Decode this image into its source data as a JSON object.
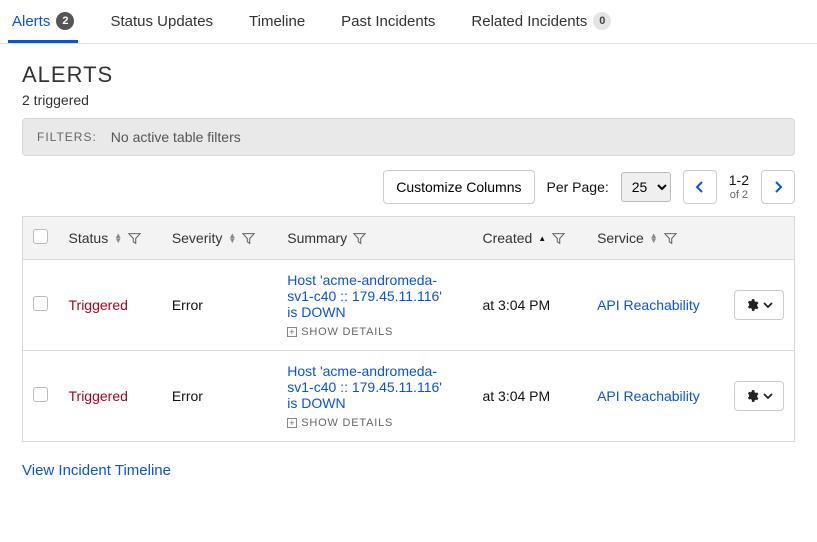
{
  "tabs": [
    {
      "label": "Alerts",
      "badge": "2",
      "badgeStyle": "dark",
      "active": true
    },
    {
      "label": "Status Updates",
      "badge": null
    },
    {
      "label": "Timeline",
      "badge": null
    },
    {
      "label": "Past Incidents",
      "badge": null
    },
    {
      "label": "Related Incidents",
      "badge": "0",
      "badgeStyle": "light"
    }
  ],
  "header": {
    "title": "ALERTS",
    "subtitle": "2 triggered"
  },
  "filters": {
    "label": "FILTERS:",
    "text": "No active table filters"
  },
  "toolbar": {
    "customize": "Customize Columns",
    "per_page_label": "Per Page:",
    "per_page_value": "25",
    "page_range": "1-2",
    "page_total": "of 2"
  },
  "columns": {
    "status": "Status",
    "severity": "Severity",
    "summary": "Summary",
    "created": "Created",
    "service": "Service"
  },
  "rows": [
    {
      "status": "Triggered",
      "severity": "Error",
      "summary": "Host 'acme-andromeda-sv1-c40 :: 179.45.11.116' is DOWN",
      "show_details": "SHOW DETAILS",
      "created": "at 3:04 PM",
      "service": "API Reachability"
    },
    {
      "status": "Triggered",
      "severity": "Error",
      "summary": "Host 'acme-andromeda-sv1-c40 :: 179.45.11.116' is DOWN",
      "show_details": "SHOW DETAILS",
      "created": "at 3:04 PM",
      "service": "API Reachability"
    }
  ],
  "footer": {
    "timeline_link": "View Incident Timeline"
  }
}
